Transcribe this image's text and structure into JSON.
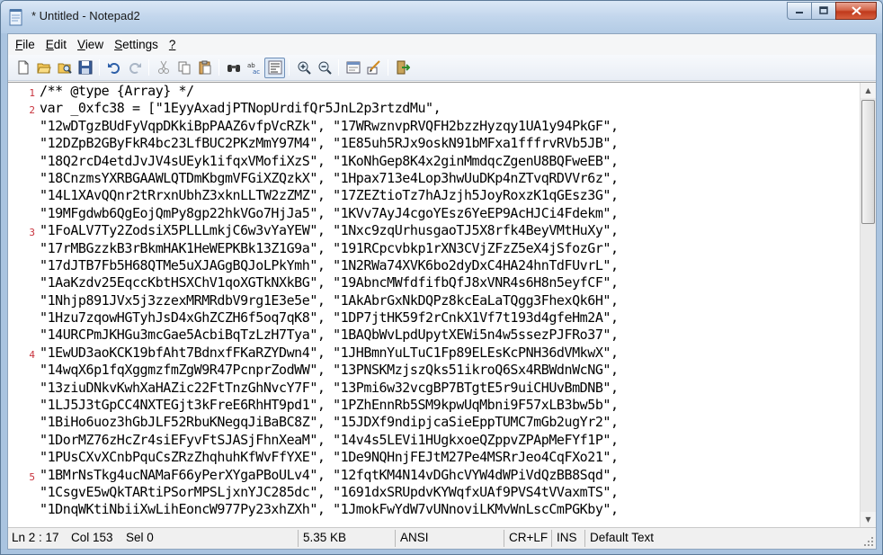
{
  "window": {
    "title": "* Untitled - Notepad2",
    "minimize_icon": "minimize-icon",
    "maximize_icon": "maximize-icon",
    "close_icon": "close-icon"
  },
  "menu": [
    {
      "label": "File",
      "u": "F",
      "rest": "ile"
    },
    {
      "label": "Edit",
      "u": "E",
      "rest": "dit"
    },
    {
      "label": "View",
      "u": "V",
      "rest": "iew"
    },
    {
      "label": "Settings",
      "u": "S",
      "rest": "ettings"
    },
    {
      "label": "?",
      "u": "?",
      "rest": ""
    }
  ],
  "toolbar_icons": [
    "new-file-icon",
    "open-file-icon",
    "browse-icon",
    "save-icon",
    "sep",
    "undo-icon",
    "redo-icon",
    "sep",
    "cut-icon",
    "copy-icon",
    "paste-icon",
    "sep",
    "find-icon",
    "replace-icon",
    "word-wrap-icon",
    "sep",
    "zoom-in-icon",
    "zoom-out-icon",
    "sep",
    "scheme-icon",
    "customize-icon",
    "sep",
    "exit-icon"
  ],
  "editor": {
    "lines": [
      {
        "num": "1",
        "text": "/** @type {Array} */"
      },
      {
        "num": "2",
        "text": "var _0xfc38 = [\"1EyyAxadjPTNopUrdifQr5JnL2p3rtzdMu\","
      },
      {
        "num": "",
        "text": "\"12wDTgzBUdFyVqpDKkiBpPAAZ6vfpVcRZk\", \"17WRwznvpRVQFH2bzzHyzqy1UA1y94PkGF\","
      },
      {
        "num": "",
        "text": "\"12DZpB2GByFkR4bc23LfBUC2PKzMmY97M4\", \"1E85uh5RJx9oskN91bMFxa1fffrvRVb5JB\","
      },
      {
        "num": "",
        "text": "\"18Q2rcD4etdJvJV4sUEyk1ifqxVMofiXzS\", \"1KoNhGep8K4x2ginMmdqcZgenU8BQFweEB\","
      },
      {
        "num": "",
        "text": "\"18CnzmsYXRBGAAWLQTDmKbgmVFGiXZQzkX\", \"1Hpax713e4Lop3hwUuDKp4nZTvqRDVVr6z\","
      },
      {
        "num": "",
        "text": "\"14L1XAvQQnr2tRrxnUbhZ3xknLLTW2zZMZ\", \"17ZEZtioTz7hAJzjh5JoyRoxzK1qGEsz3G\","
      },
      {
        "num": "",
        "text": "\"19MFgdwb6QgEojQmPy8gp22hkVGo7HjJa5\", \"1KVv7AyJ4cgoYEsz6YeEP9AcHJCi4Fdekm\","
      },
      {
        "num": "3",
        "text": "\"1FoALV7Ty2ZodsiX5PLLLmkjC6w3vYaYEW\", \"1Nxc9zqUrhusgaoTJ5X8rfk4BeyVMtHuXy\","
      },
      {
        "num": "",
        "text": "\"17rMBGzzkB3rBkmHAK1HeWEPKBk13Z1G9a\", \"191RCpcvbkp1rXN3CVjZFzZ5eX4jSfozGr\","
      },
      {
        "num": "",
        "text": "\"17dJTB7Fb5H68QTMe5uXJAGgBQJoLPkYmh\", \"1N2RWa74XVK6bo2dyDxC4HA24hnTdFUvrL\","
      },
      {
        "num": "",
        "text": "\"1AaKzdv25EqccKbtHSXChV1qoXGTkNXkBG\", \"19AbncMWfdfifbQfJ8xVNR4s6H8n5eyfCF\","
      },
      {
        "num": "",
        "text": "\"1Nhjp891JVx5j3zzexMRMRdbV9rg1E3e5e\", \"1AkAbrGxNkDQPz8kcEaLaTQgg3FhexQk6H\","
      },
      {
        "num": "",
        "text": "\"1Hzu7zqowHGTyhJsD4xGhZCZH6f5oq7qK8\", \"1DP7jtHK59f2rCnkX1Vf7t193d4gfeHm2A\","
      },
      {
        "num": "",
        "text": "\"14URCPmJKHGu3mcGae5AcbiBqTzLzH7Tya\", \"1BAQbWvLpdUpytXEWi5n4w5ssezPJFRo37\","
      },
      {
        "num": "4",
        "text": "\"1EwUD3aoKCK19bfAht7BdnxfFKaRZYDwn4\", \"1JHBmnYuLTuC1Fp89ELEsKcPNH36dVMkwX\","
      },
      {
        "num": "",
        "text": "\"14wqX6p1fqXggmzfmZgW9R47PcnprZodWW\", \"13PNSKMzjszQks51ikroQ6Sx4RBWdnWcNG\","
      },
      {
        "num": "",
        "text": "\"13ziuDNkvKwhXaHAZic22FtTnzGhNvcY7F\", \"13Pmi6w32vcgBP7BTgtE5r9uiCHUvBmDNB\","
      },
      {
        "num": "",
        "text": "\"1LJ5J3tGpCC4NXTEGjt3kFreE6RhHT9pd1\", \"1PZhEnnRb5SM9kpwUqMbni9F57xLB3bw5b\","
      },
      {
        "num": "",
        "text": "\"1BiHo6uoz3hGbJLF52RbuKNegqJiBaBC8Z\", \"15JDXf9ndipjcaSieEppTUMC7mGb2ugYr2\","
      },
      {
        "num": "",
        "text": "\"1DorMZ76zHcZr4siEFyvFtSJASjFhnXeaM\", \"14v4s5LEVi1HUgkxoeQZppvZPApMeFYf1P\","
      },
      {
        "num": "",
        "text": "\"1PUsCXvXCnbPquCsZRzZhqhuhKfWvFfYXE\", \"1De9NQHnjFEJtM27Pe4MSRrJeo4CqFXo21\","
      },
      {
        "num": "5",
        "text": "\"1BMrNsTkg4ucNAMaF66yPerXYgaPBoULv4\", \"12fqtKM4N14vDGhcVYW4dWPiVdQzBB8Sqd\","
      },
      {
        "num": "",
        "text": "\"1CsgvE5wQkTARtiPSorMPSLjxnYJC285dc\", \"1691dxSRUpdvKYWqfxUAf9PVS4tVVaxmTS\","
      },
      {
        "num": "",
        "text": "\"1DnqWKtiNbiiXwLihEoncW977Py23xhZXh\", \"1JmokFwYdW7vUNnoviLKMvWnLscCmPGKby\","
      }
    ]
  },
  "status": {
    "position": "Ln 2 : 17",
    "col": "Col 153",
    "sel": "Sel 0",
    "size": "5.35 KB",
    "encoding": "ANSI",
    "eol": "CR+LF",
    "ins": "INS",
    "scheme": "Default Text"
  }
}
